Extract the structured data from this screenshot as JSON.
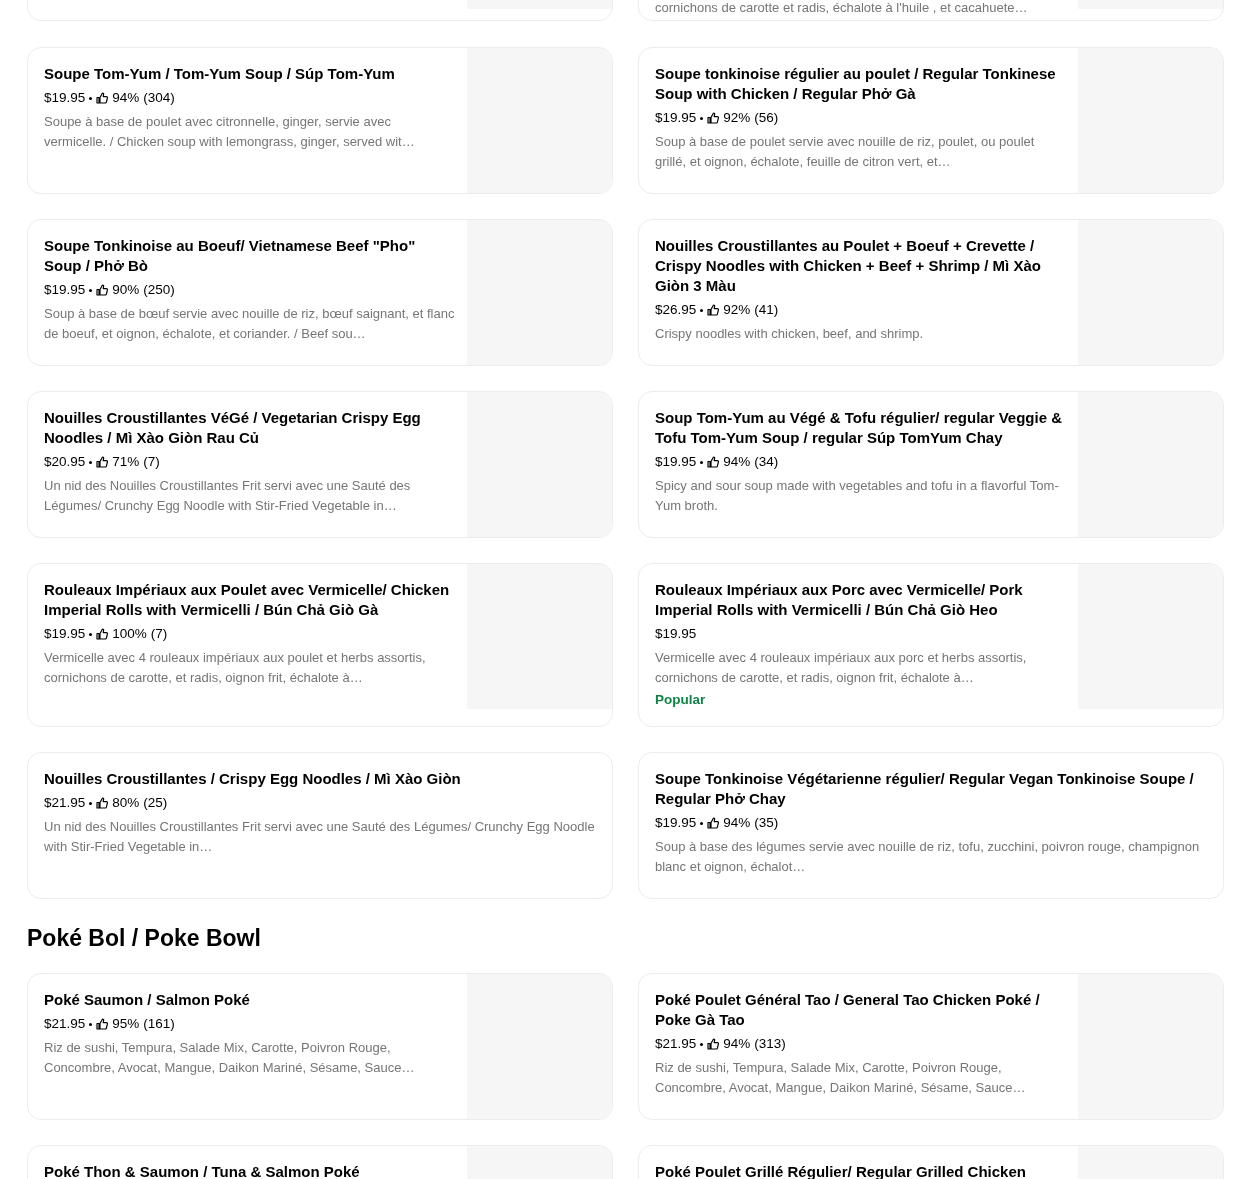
{
  "top_row": [
    {
      "has_image": true
    },
    {
      "has_image": true,
      "description": "cornichons de carotte et radis, échalote à l'huile , et cacahuete…"
    }
  ],
  "items": [
    {
      "title": "Soupe Tom-Yum / Tom-Yum Soup / Súp Tom-Yum",
      "price": "$19.95",
      "rating": "94%",
      "reviews": "(304)",
      "description": "Soupe à base de poulet avec citronnelle, ginger, servie avec vermicelle. / Chicken soup with lemongrass, ginger, served wit…",
      "has_image": true
    },
    {
      "title": "Soupe tonkinoise régulier au poulet / Regular Tonkinese Soup with Chicken / Regular Phở Gà",
      "price": "$19.95",
      "rating": "92%",
      "reviews": "(56)",
      "description": "Soup à base de poulet servie avec nouille de riz, poulet, ou poulet grillé, et oignon, échalote, feuille de citron vert, et…",
      "has_image": true
    },
    {
      "title": "Soupe Tonkinoise au Boeuf/ Vietnamese Beef \"Pho\" Soup / Phở Bò",
      "price": "$19.95",
      "rating": "90%",
      "reviews": "(250)",
      "description": "Soup à base de bœuf servie avec nouille de riz, bœuf saignant, et flanc de boeuf, et oignon, échalote, et coriander. / Beef sou…",
      "has_image": true
    },
    {
      "title": "Nouilles Croustillantes au Poulet + Boeuf + Crevette / Crispy Noodles with Chicken + Beef + Shrimp / Mì Xào Giòn 3 Màu",
      "price": "$26.95",
      "rating": "92%",
      "reviews": "(41)",
      "description": "Crispy noodles with chicken, beef, and shrimp.",
      "has_image": true
    },
    {
      "title": "Nouilles Croustillantes VéGé / Vegetarian Crispy Egg Noodles / Mì Xào Giòn Rau Củ",
      "price": "$20.95",
      "rating": "71%",
      "reviews": "(7)",
      "description": "Un nid des Nouilles Croustillantes Frit servi avec une Sauté des Légumes/ Crunchy Egg Noodle with Stir-Fried Vegetable in…",
      "has_image": true
    },
    {
      "title": "Soup Tom-Yum  au Végé & Tofu régulier/ regular Veggie & Tofu Tom-Yum Soup / regular Súp TomYum Chay",
      "price": "$19.95",
      "rating": "94%",
      "reviews": "(34)",
      "description": "Spicy and sour soup made with vegetables and tofu in a flavorful Tom-Yum broth.",
      "has_image": true
    },
    {
      "title": "Rouleaux Impériaux aux Poulet avec Vermicelle/ Chicken Imperial Rolls with Vermicelli / Bún Chả Giò Gà",
      "price": "$19.95",
      "rating": "100%",
      "reviews": "(7)",
      "description": "Vermicelle avec 4 rouleaux impériaux aux poulet et herbs assortis, cornichons de carotte, et radis, oignon frit, échalote à…",
      "has_image": true
    },
    {
      "title": "Rouleaux Impériaux aux Porc avec Vermicelle/ Pork Imperial Rolls with Vermicelli / Bún Chả Giò Heo",
      "price": "$19.95",
      "description": "Vermicelle avec 4 rouleaux impériaux aux porc et herbs assortis, cornichons de carotte, et radis, oignon frit, échalote à…",
      "badge": "Popular",
      "has_image": true
    },
    {
      "title": "Nouilles Croustillantes / Crispy Egg Noodles / Mì Xào Giòn",
      "price": "$21.95",
      "rating": "80%",
      "reviews": "(25)",
      "description": "Un nid des Nouilles Croustillantes Frit servi avec une Sauté des Légumes/ Crunchy Egg Noodle with Stir-Fried Vegetable in…",
      "has_image": false
    },
    {
      "title": "Soupe Tonkinoise Végétarienne régulier/ Regular Vegan Tonkinoise Soupe / Regular Phở Chay",
      "price": "$19.95",
      "rating": "94%",
      "reviews": "(35)",
      "description": "Soup à base des légumes servie avec nouille de riz, tofu, zucchini, poivron rouge, champignon blanc et oignon, échalot…",
      "has_image": false
    }
  ],
  "section": {
    "title": "Poké Bol / Poke Bowl",
    "items": [
      {
        "title": "Poké Saumon / Salmon Poké",
        "price": "$21.95",
        "rating": "95%",
        "reviews": "(161)",
        "description": "Riz de sushi, Tempura, Salade Mix, Carotte, Poivron Rouge, Concombre, Avocat, Mangue, Daikon Mariné, Sésame, Sauce…",
        "has_image": true
      },
      {
        "title": "Poké Poulet Général Tao / General Tao Chicken Poké / Poke Gà Tao",
        "price": "$21.95",
        "rating": "94%",
        "reviews": "(313)",
        "description": "Riz de sushi, Tempura, Salade Mix, Carotte, Poivron Rouge, Concombre, Avocat, Mangue, Daikon Mariné, Sésame, Sauce…",
        "has_image": true
      },
      {
        "title": "Poké Thon & Saumon / Tuna & Salmon Poké",
        "has_image": true
      },
      {
        "title": "Poké Poulet Grillé Régulier/ Regular Grilled Chicken",
        "has_image": true
      }
    ]
  }
}
